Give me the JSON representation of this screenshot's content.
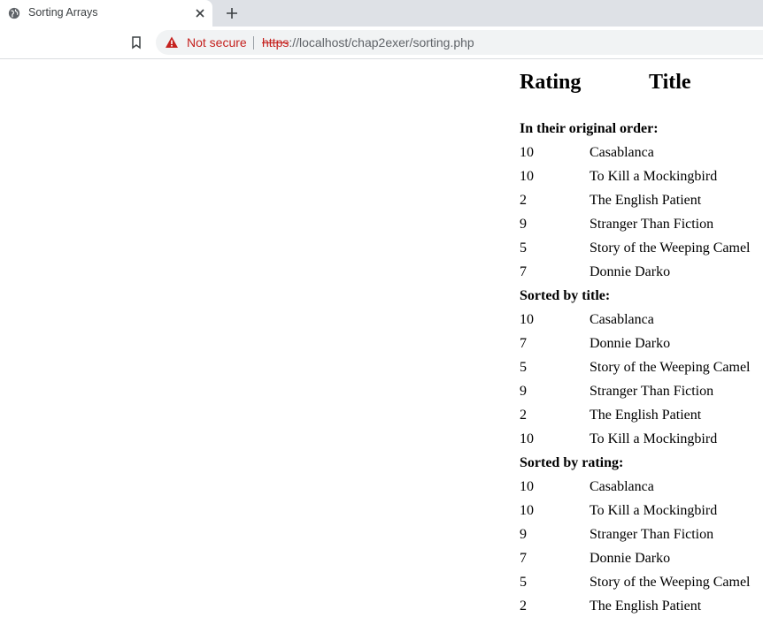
{
  "browser": {
    "tab_title": "Sorting Arrays",
    "security_label": "Not secure",
    "url_scheme": "https",
    "url_rest": "://localhost/chap2exer/sorting.php"
  },
  "table": {
    "header_rating": "Rating",
    "header_title": "Title",
    "sections": [
      {
        "heading": "In their original order:",
        "rows": [
          {
            "rating": "10",
            "title": "Casablanca"
          },
          {
            "rating": "10",
            "title": "To Kill a Mockingbird"
          },
          {
            "rating": "2",
            "title": "The English Patient"
          },
          {
            "rating": "9",
            "title": "Stranger Than Fiction"
          },
          {
            "rating": "5",
            "title": "Story of the Weeping Camel"
          },
          {
            "rating": "7",
            "title": "Donnie Darko"
          }
        ]
      },
      {
        "heading": "Sorted by title:",
        "rows": [
          {
            "rating": "10",
            "title": "Casablanca"
          },
          {
            "rating": "7",
            "title": "Donnie Darko"
          },
          {
            "rating": "5",
            "title": "Story of the Weeping Camel"
          },
          {
            "rating": "9",
            "title": "Stranger Than Fiction"
          },
          {
            "rating": "2",
            "title": "The English Patient"
          },
          {
            "rating": "10",
            "title": "To Kill a Mockingbird"
          }
        ]
      },
      {
        "heading": "Sorted by rating:",
        "rows": [
          {
            "rating": "10",
            "title": "Casablanca"
          },
          {
            "rating": "10",
            "title": "To Kill a Mockingbird"
          },
          {
            "rating": "9",
            "title": "Stranger Than Fiction"
          },
          {
            "rating": "7",
            "title": "Donnie Darko"
          },
          {
            "rating": "5",
            "title": "Story of the Weeping Camel"
          },
          {
            "rating": "2",
            "title": "The English Patient"
          }
        ]
      }
    ]
  }
}
